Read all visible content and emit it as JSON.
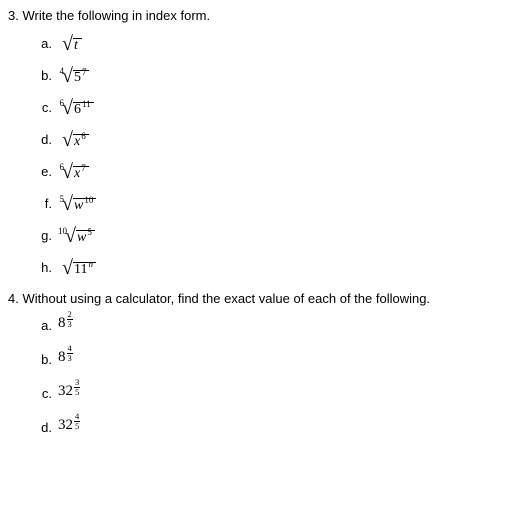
{
  "questions": [
    {
      "number": "3.",
      "prompt": "Write the following in index form.",
      "items": [
        {
          "label": "a.",
          "type": "root",
          "index": "",
          "base": "t",
          "baseItalic": true,
          "exp": ""
        },
        {
          "label": "b.",
          "type": "root",
          "index": "4",
          "base": "5",
          "baseItalic": false,
          "exp": "7"
        },
        {
          "label": "c.",
          "type": "root",
          "index": "6",
          "base": "6",
          "baseItalic": false,
          "exp": "11"
        },
        {
          "label": "d.",
          "type": "root",
          "index": "",
          "base": "x",
          "baseItalic": true,
          "exp": "6"
        },
        {
          "label": "e.",
          "type": "root",
          "index": "6",
          "base": "x",
          "baseItalic": true,
          "exp": "7"
        },
        {
          "label": "f.",
          "type": "root",
          "index": "5",
          "base": "w",
          "baseItalic": true,
          "exp": "10"
        },
        {
          "label": "g.",
          "type": "root",
          "index": "10",
          "base": "w",
          "baseItalic": true,
          "exp": "5"
        },
        {
          "label": "h.",
          "type": "root",
          "index": "",
          "base": "11",
          "baseItalic": false,
          "exp": "n"
        }
      ]
    },
    {
      "number": "4.",
      "prompt": "Without using a calculator, find the exact value of each of the following.",
      "items": [
        {
          "label": "a.",
          "type": "power",
          "pbase": "8",
          "pnum": "2",
          "pden": "3"
        },
        {
          "label": "b.",
          "type": "power",
          "pbase": "8",
          "pnum": "4",
          "pden": "3"
        },
        {
          "label": "c.",
          "type": "power",
          "pbase": "32",
          "pnum": "3",
          "pden": "5"
        },
        {
          "label": "d.",
          "type": "power",
          "pbase": "32",
          "pnum": "4",
          "pden": "5"
        }
      ]
    }
  ],
  "chart_data": {
    "type": "table",
    "title": "Questions 3 and 4 — radical and index form expressions",
    "q3_items": [
      {
        "label": "a",
        "root_index": 2,
        "radicand_base": "t",
        "radicand_exponent": 1
      },
      {
        "label": "b",
        "root_index": 4,
        "radicand_base": 5,
        "radicand_exponent": 7
      },
      {
        "label": "c",
        "root_index": 6,
        "radicand_base": 6,
        "radicand_exponent": 11
      },
      {
        "label": "d",
        "root_index": 2,
        "radicand_base": "x",
        "radicand_exponent": 6
      },
      {
        "label": "e",
        "root_index": 6,
        "radicand_base": "x",
        "radicand_exponent": 7
      },
      {
        "label": "f",
        "root_index": 5,
        "radicand_base": "w",
        "radicand_exponent": 10
      },
      {
        "label": "g",
        "root_index": 10,
        "radicand_base": "w",
        "radicand_exponent": 5
      },
      {
        "label": "h",
        "root_index": 2,
        "radicand_base": 11,
        "radicand_exponent": "n"
      }
    ],
    "q4_items": [
      {
        "label": "a",
        "base": 8,
        "exp_numerator": 2,
        "exp_denominator": 3
      },
      {
        "label": "b",
        "base": 8,
        "exp_numerator": 4,
        "exp_denominator": 3
      },
      {
        "label": "c",
        "base": 32,
        "exp_numerator": 3,
        "exp_denominator": 5
      },
      {
        "label": "d",
        "base": 32,
        "exp_numerator": 4,
        "exp_denominator": 5
      }
    ]
  }
}
